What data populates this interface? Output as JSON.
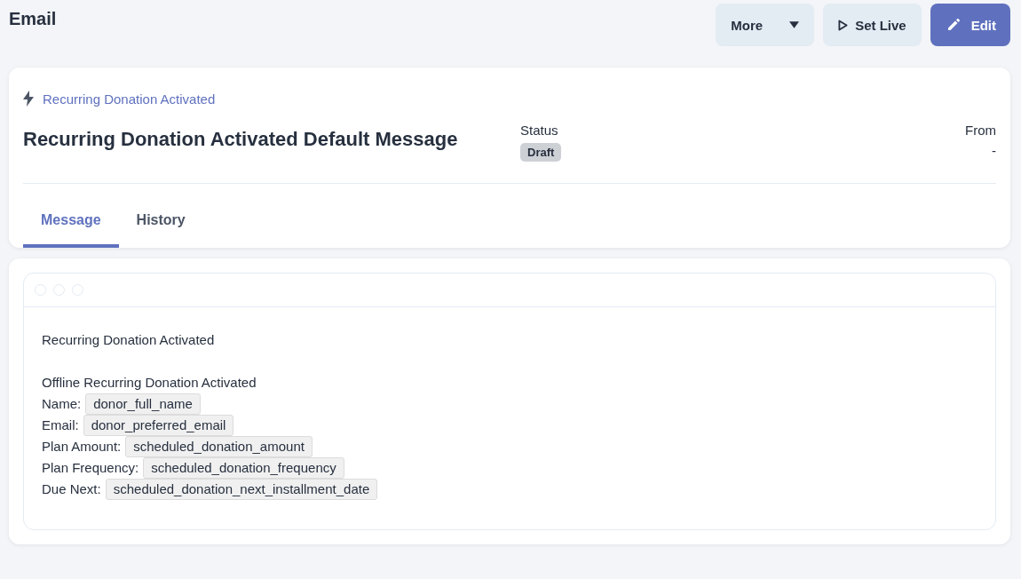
{
  "page": {
    "title": "Email"
  },
  "actions": [
    {
      "kind": "menu",
      "label": "More"
    },
    {
      "kind": "play",
      "label": "Set Live"
    },
    {
      "kind": "edit",
      "label": "Edit"
    }
  ],
  "header": {
    "trigger": "Recurring Donation Activated",
    "title": "Recurring Donation Activated Default Message",
    "status_label": "Status",
    "status": "Draft",
    "from_label": "From",
    "from": "-"
  },
  "tabs": [
    {
      "label": "Message",
      "selected": true
    },
    {
      "label": "History",
      "selected": false
    }
  ],
  "message": {
    "lines": [
      {
        "kind": "text",
        "text": "Recurring Donation Activated"
      },
      {
        "kind": "blank"
      },
      {
        "kind": "text",
        "text": "Offline Recurring Donation Activated"
      },
      {
        "kind": "field",
        "label": "Name:",
        "token": "donor_full_name"
      },
      {
        "kind": "field",
        "label": "Email:",
        "token": "donor_preferred_email"
      },
      {
        "kind": "field",
        "label": "Plan Amount:",
        "token": "scheduled_donation_amount"
      },
      {
        "kind": "field",
        "label": "Plan Frequency:",
        "token": "scheduled_donation_frequency"
      },
      {
        "kind": "field",
        "label": "Due Next:",
        "token": "scheduled_donation_next_installment_date"
      }
    ]
  }
}
